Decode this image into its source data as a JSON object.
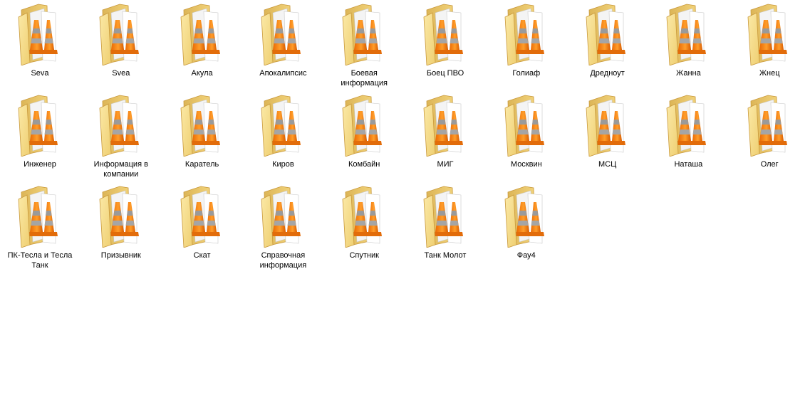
{
  "window": {
    "view_mode": "large-icons"
  },
  "icon": {
    "type": "folder-icon",
    "overlay": "vlc-cone-icon",
    "colors": {
      "folder_back": "#e9c766",
      "folder_front": "#f6dd8b",
      "folder_edge": "#d6a94a",
      "paper": "#ffffff",
      "cone_orange": "#f07c0d",
      "cone_stripe": "#ffffff",
      "cone_shadow": "#8c8c8c"
    }
  },
  "folders": [
    {
      "label": "Seva"
    },
    {
      "label": "Svea"
    },
    {
      "label": "Акула"
    },
    {
      "label": "Апокалипсис"
    },
    {
      "label": "Боевая информация"
    },
    {
      "label": "Боец ПВО"
    },
    {
      "label": "Голиаф"
    },
    {
      "label": "Дредноут"
    },
    {
      "label": "Жанна"
    },
    {
      "label": "Жнец"
    },
    {
      "label": "Инженер"
    },
    {
      "label": "Информация в компании"
    },
    {
      "label": "Каратель"
    },
    {
      "label": "Киров"
    },
    {
      "label": "Комбайн"
    },
    {
      "label": "МИГ"
    },
    {
      "label": "Москвин"
    },
    {
      "label": "МСЦ"
    },
    {
      "label": "Наташа"
    },
    {
      "label": "Олег"
    },
    {
      "label": "ПК-Тесла и Тесла Танк"
    },
    {
      "label": "Призывник"
    },
    {
      "label": "Скат"
    },
    {
      "label": "Справочная информация"
    },
    {
      "label": "Спутник"
    },
    {
      "label": "Танк Молот"
    },
    {
      "label": "Фау4"
    }
  ]
}
